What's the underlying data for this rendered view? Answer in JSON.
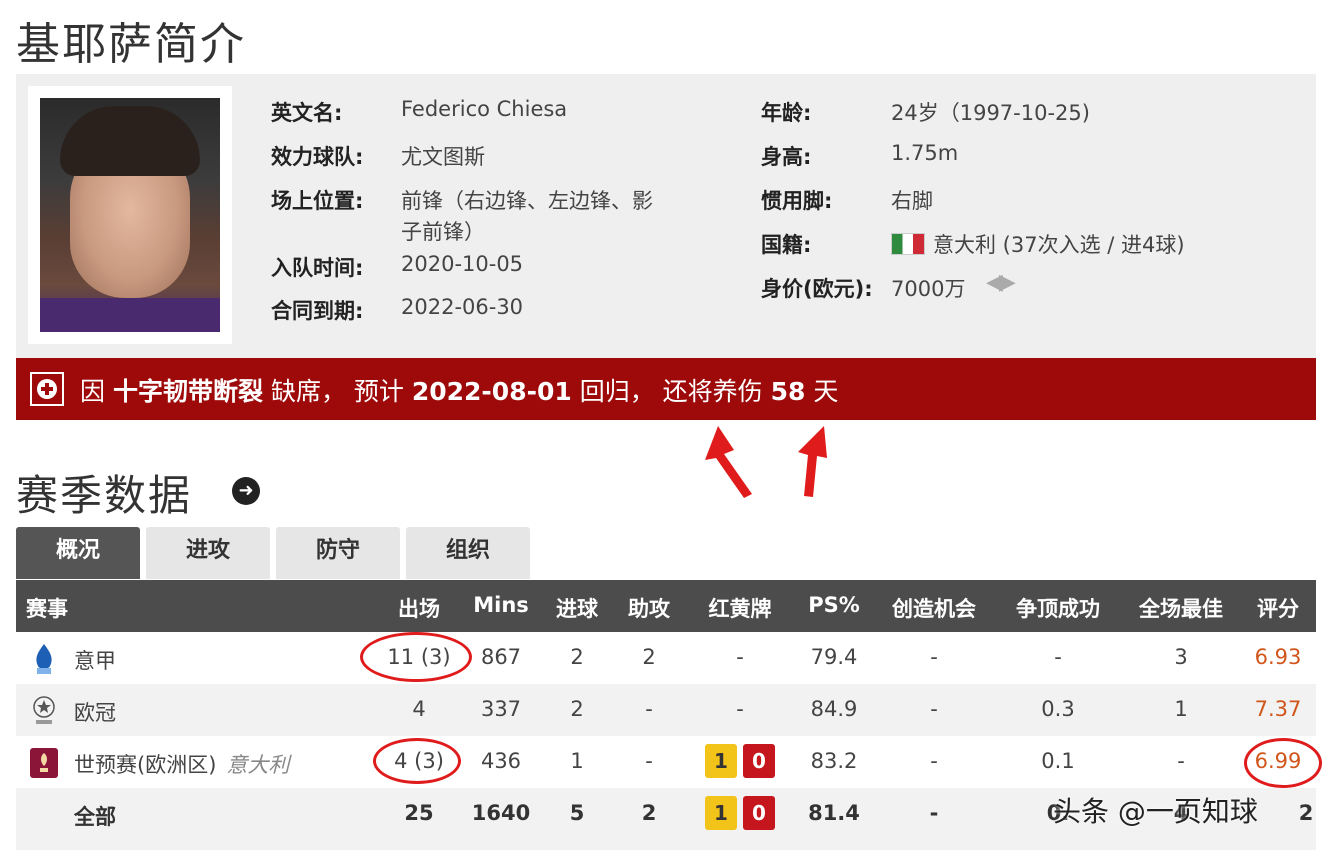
{
  "page_title": "基耶萨简介",
  "profile": {
    "english_name_label": "英文名:",
    "english_name": "Federico Chiesa",
    "team_label": "效力球队:",
    "team": "尤文图斯",
    "position_label": "场上位置:",
    "position_line1": "前锋（右边锋、左边锋、影",
    "position_line2": "子前锋）",
    "join_label": "入队时间:",
    "join_date": "2020-10-05",
    "contract_label": "合同到期:",
    "contract_date": "2022-06-30",
    "age_label": "年龄:",
    "age": "24岁（1997-10-25)",
    "height_label": "身高:",
    "height": "1.75m",
    "foot_label": "惯用脚:",
    "foot": "右脚",
    "nationality_label": "国籍:",
    "nationality": "意大利 (37次入选 / 进4球)",
    "value_label": "身价(欧元):",
    "value": "7000万",
    "flag_colors": [
      "#2e8b3e",
      "#ffffff",
      "#cf2b37"
    ]
  },
  "injury": {
    "prefix": "因",
    "injury_name": "十字韧带断裂",
    "mid1": "缺席，   预计",
    "return_date": "2022-08-01",
    "mid2": "回归，  还将养伤",
    "days": "58",
    "suffix": "天",
    "background_color": "#9e0a0a"
  },
  "season": {
    "title": "赛季数据",
    "tabs": [
      "概况",
      "进攻",
      "防守",
      "组织"
    ],
    "active_tab": "概况"
  },
  "table": {
    "headers": {
      "competition": "赛事",
      "apps": "出场",
      "mins": "Mins",
      "goals": "进球",
      "assists": "助攻",
      "cards": "红黄牌",
      "ps": "PS%",
      "chances": "创造机会",
      "aerials": "争顶成功",
      "motm": "全场最佳",
      "rating": "评分"
    },
    "rows": [
      {
        "competition": "意甲",
        "icon": "serie-a-icon",
        "apps": "11 (3)",
        "mins": "867",
        "goals": "2",
        "assists": "2",
        "cards": "-",
        "ps": "79.4",
        "chances": "-",
        "aerials": "-",
        "motm": "3",
        "rating": "6.93"
      },
      {
        "competition": "欧冠",
        "icon": "champions-league-icon",
        "apps": "4",
        "mins": "337",
        "goals": "2",
        "assists": "-",
        "cards": "-",
        "ps": "84.9",
        "chances": "-",
        "aerials": "0.3",
        "motm": "1",
        "rating": "7.37"
      },
      {
        "competition": "世预赛(欧洲区)",
        "nation": "意大利",
        "icon": "world-cup-qualifier-icon",
        "apps": "4 (3)",
        "mins": "436",
        "goals": "1",
        "assists": "-",
        "yellow": "1",
        "red": "0",
        "ps": "83.2",
        "chances": "-",
        "aerials": "0.1",
        "motm": "-",
        "rating": "6.99"
      },
      {
        "competition": "全部",
        "apps": "25",
        "mins": "1640",
        "goals": "5",
        "assists": "2",
        "yellow": "1",
        "red": "0",
        "ps": "81.4",
        "chances": "-",
        "aerials": "0.",
        "motm": "4",
        "rating": "2"
      }
    ]
  },
  "watermark": "头条 @一页知球",
  "colors": {
    "rating": "#d0561b",
    "yellow_card": "#f2c318",
    "red_card": "#c5161d",
    "annotation_red": "#e01b1b"
  }
}
